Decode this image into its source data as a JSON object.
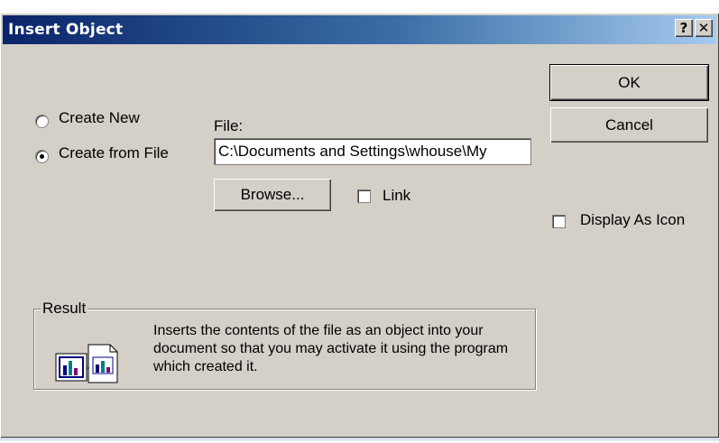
{
  "window": {
    "title": "Insert Object",
    "help_label": "?",
    "close_label": "✕"
  },
  "options": {
    "create_new_label": "Create New",
    "create_from_file_label": "Create from File",
    "selected": "create_from_file"
  },
  "file": {
    "label": "File:",
    "value": "C:\\Documents and Settings\\whouse\\My"
  },
  "buttons": {
    "ok": "OK",
    "cancel": "Cancel",
    "browse": "Browse..."
  },
  "checkboxes": {
    "link_label": "Link",
    "link_checked": false,
    "display_as_icon_label": "Display As Icon",
    "display_as_icon_checked": false
  },
  "result": {
    "label": "Result",
    "description": "Inserts the contents of the file as an object into your document so that you may activate it using the program which created it.",
    "icon": "file-object-icon"
  },
  "colors": {
    "face": "#d4d0c8",
    "title_start": "#0a246a",
    "title_end": "#a6caf0"
  }
}
